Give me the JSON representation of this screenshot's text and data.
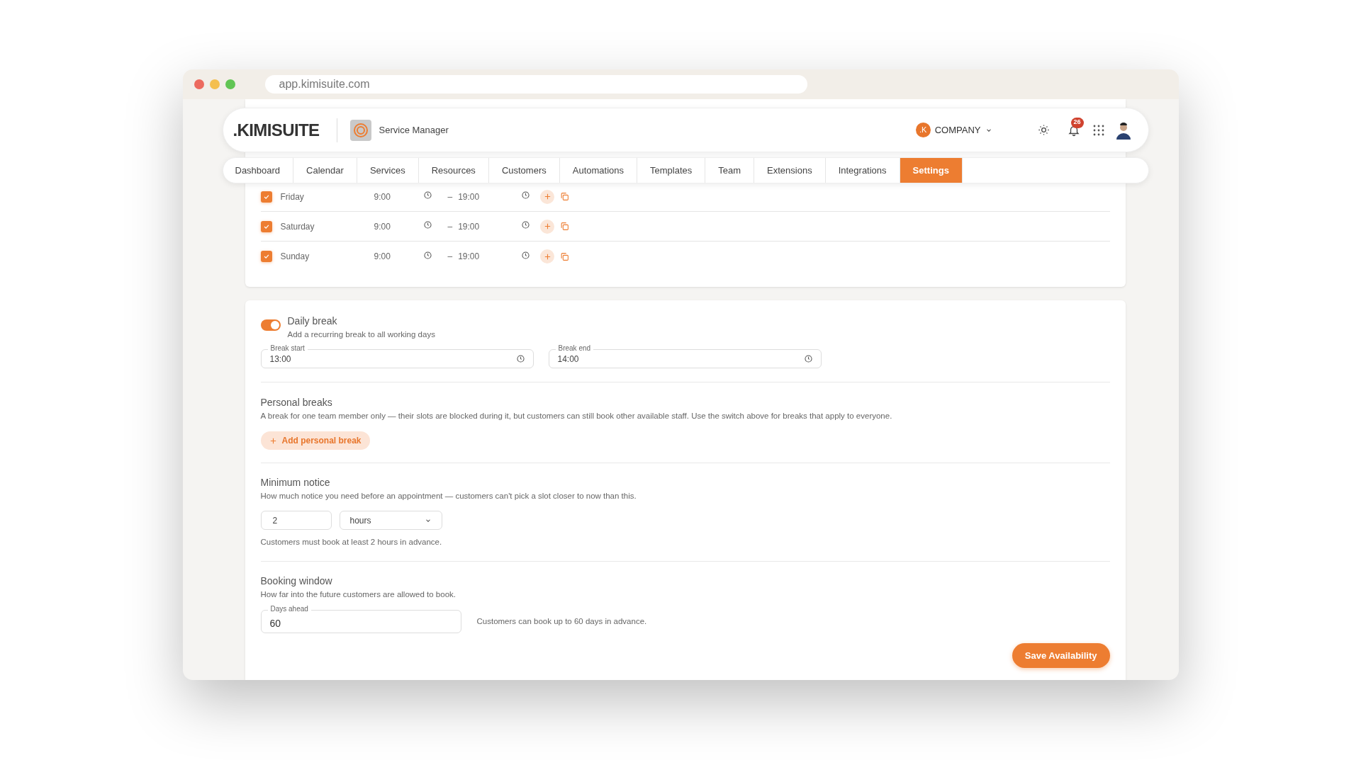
{
  "browser": {
    "url": "app.kimisuite.com"
  },
  "header": {
    "logo": ".KIMISUITE",
    "app_name": "Service Manager",
    "company_initial": ".K",
    "company": "COMPANY",
    "notifications": "26"
  },
  "nav": [
    {
      "label": "Dashboard",
      "selected": false
    },
    {
      "label": "Calendar",
      "selected": false
    },
    {
      "label": "Services",
      "selected": false
    },
    {
      "label": "Resources",
      "selected": false
    },
    {
      "label": "Customers",
      "selected": false
    },
    {
      "label": "Automations",
      "selected": false
    },
    {
      "label": "Templates",
      "selected": false
    },
    {
      "label": "Team",
      "selected": false
    },
    {
      "label": "Extensions",
      "selected": false
    },
    {
      "label": "Integrations",
      "selected": false
    },
    {
      "label": "Settings",
      "selected": true
    }
  ],
  "schedule": [
    {
      "day": "Friday",
      "checked": true,
      "start": "9:00",
      "separator": "–",
      "end": "19:00"
    },
    {
      "day": "Saturday",
      "checked": true,
      "start": "9:00",
      "separator": "–",
      "end": "19:00"
    },
    {
      "day": "Sunday",
      "checked": true,
      "start": "9:00",
      "separator": "–",
      "end": "19:00"
    }
  ],
  "daily_break": {
    "title": "Daily break",
    "description": "Add a recurring break to all working days",
    "on": true,
    "start_label": "Break start",
    "start": "13:00",
    "end_label": "Break end",
    "end": "14:00"
  },
  "personal_breaks": {
    "title": "Personal breaks",
    "description": "A break for one team member only — their slots are blocked during it, but customers can still book other available staff. Use the switch above for breaks that apply to everyone.",
    "button": "Add personal break"
  },
  "minimum_notice": {
    "title": "Minimum notice",
    "description": "How much notice you need before an appointment — customers can't pick a slot closer to now than this.",
    "amount": "2",
    "unit": "hours",
    "helper": "Customers must book at least 2 hours in advance."
  },
  "booking_window": {
    "title": "Booking window",
    "description": "How far into the future customers are allowed to book.",
    "label": "Days ahead",
    "value": "60",
    "helper": "Customers can book up to 60 days in advance."
  },
  "save_button": "Save Availability"
}
